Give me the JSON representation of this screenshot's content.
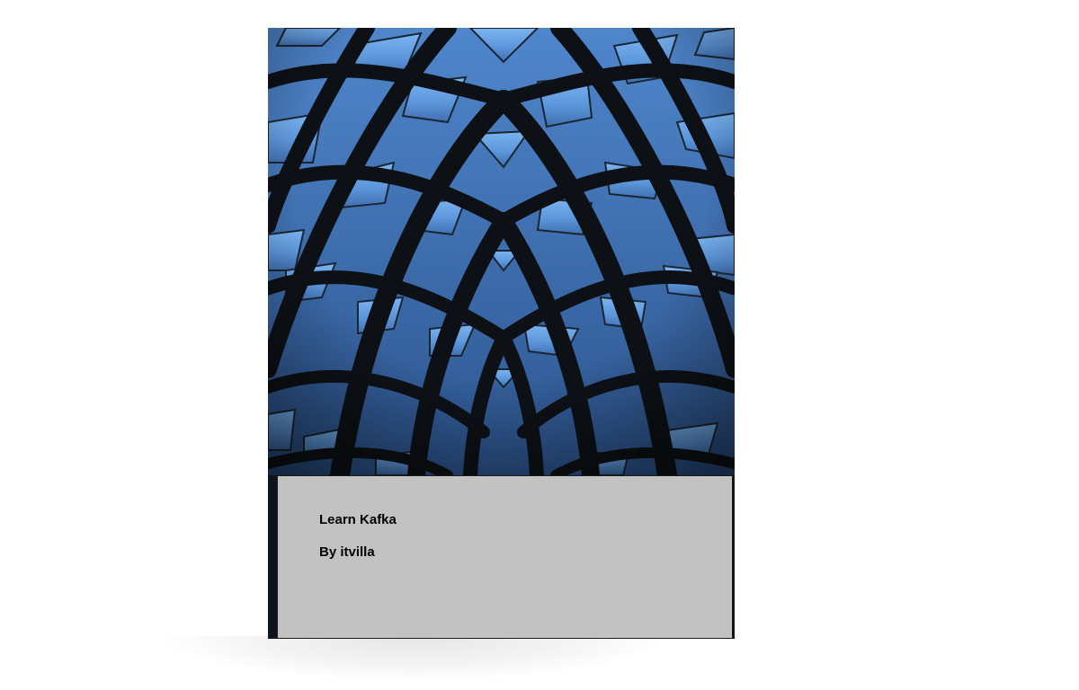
{
  "book": {
    "title": "Learn Kafka",
    "author": "By itvilla"
  },
  "cover_image": {
    "icon": "architectural-glass-dome-image",
    "colors": {
      "sky": "#6aa6e6",
      "panel_light": "#5f93d6",
      "panel_dark": "#2a4f86",
      "frame": "#0d1116"
    }
  },
  "colors": {
    "page_background": "#ffffff",
    "title_panel": "#c2c2c2",
    "text": "#000000"
  }
}
